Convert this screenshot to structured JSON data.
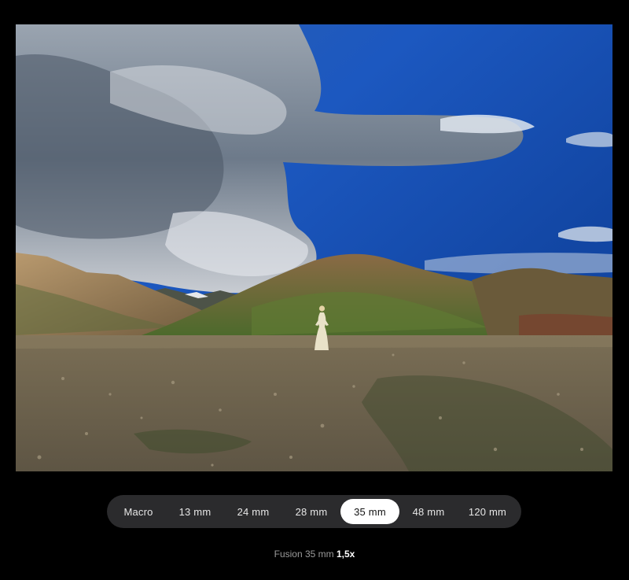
{
  "photo": {
    "icon": "landscape-photo",
    "sky_color": "#1f5bb8",
    "ground_color": "#6b604a"
  },
  "lens_selector": {
    "selected_index": 4,
    "options": [
      {
        "label": "Macro"
      },
      {
        "label": "13 mm"
      },
      {
        "label": "24 mm"
      },
      {
        "label": "28 mm"
      },
      {
        "label": "35 mm"
      },
      {
        "label": "48 mm"
      },
      {
        "label": "120 mm"
      }
    ]
  },
  "caption": {
    "text": "Fusion 35 mm",
    "zoom": "1,5x"
  }
}
